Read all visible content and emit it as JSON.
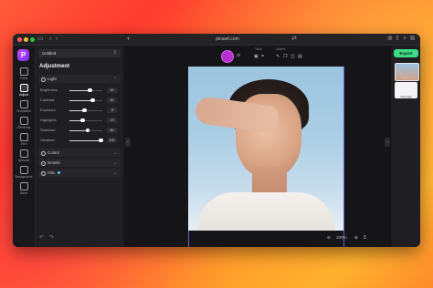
{
  "browser": {
    "url": "picsart.com",
    "nav_back": "‹",
    "nav_forward": "›",
    "shield": "◐",
    "extra_icons": [
      "⊕",
      "⇪",
      "+",
      "⧉"
    ]
  },
  "app": {
    "logo_text": "P",
    "project_name": "Untitled",
    "panel_title": "Adjustment"
  },
  "rail": {
    "items": [
      {
        "label": "Tools",
        "icon": "tools-icon",
        "active": false
      },
      {
        "label": "Adjust",
        "icon": "adjust-icon",
        "active": true
      },
      {
        "label": "Templates",
        "icon": "templates-icon",
        "active": false
      },
      {
        "label": "Elements",
        "icon": "elements-icon",
        "active": false
      },
      {
        "label": "Text",
        "icon": "text-icon",
        "active": false
      },
      {
        "label": "Uploads",
        "icon": "uploads-icon",
        "active": false
      },
      {
        "label": "Background",
        "icon": "background-icon",
        "active": false
      },
      {
        "label": "More",
        "icon": "more-icon",
        "active": false
      }
    ]
  },
  "light_section": {
    "label": "Light",
    "chevron": "⌃"
  },
  "sliders": [
    {
      "label": "Brightness",
      "value": "20",
      "position": 0.62
    },
    {
      "label": "Contrast",
      "value": "40",
      "position": 0.7
    },
    {
      "label": "Exposure",
      "value": "-9",
      "position": 0.45
    },
    {
      "label": "Highlights",
      "value": "-17",
      "position": 0.4
    },
    {
      "label": "Shadows",
      "value": "60",
      "position": 0.55
    },
    {
      "label": "Vibrance",
      "value": "100",
      "position": 0.95
    }
  ],
  "sections": [
    {
      "label": "Colors",
      "chevron": "⌄"
    },
    {
      "label": "Details",
      "chevron": "⌄"
    },
    {
      "label": "HSL",
      "chevron": "⌄"
    }
  ],
  "toolbar": {
    "color_swatch": "#b62fd0",
    "group_tools_label": "Tools",
    "group_actions_label": "Actions"
  },
  "canvas": {
    "zoom": "100%",
    "zoom_out": "⊖",
    "zoom_in": "⊕"
  },
  "undo": {
    "undo": "↶",
    "redo": "↷"
  },
  "right_panel": {
    "export_label": "Export",
    "page1_label": "Page 1",
    "page2_label": "Add page"
  }
}
